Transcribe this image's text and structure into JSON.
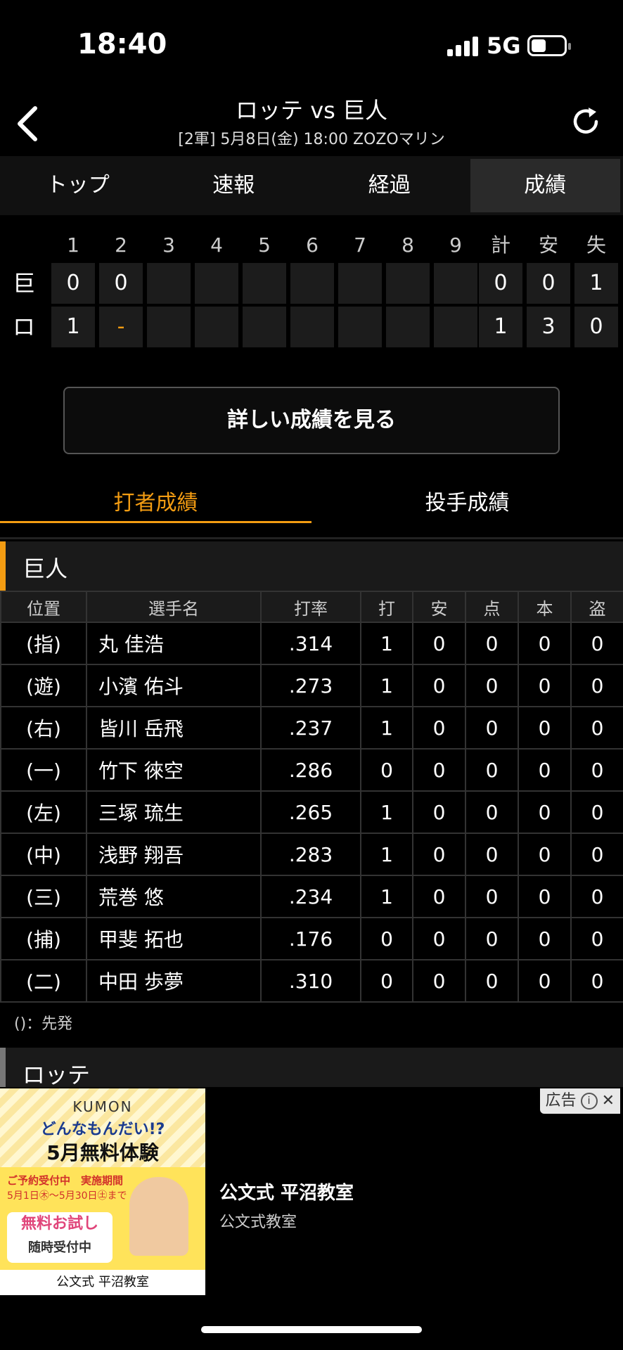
{
  "status": {
    "time": "18:40",
    "network": "5G"
  },
  "header": {
    "title": "ロッテ vs 巨人",
    "subtitle": "[2軍] 5月8日(金) 18:00 ZOZOマリン"
  },
  "tabs": [
    {
      "label": "トップ",
      "active": false
    },
    {
      "label": "速報",
      "active": false
    },
    {
      "label": "経過",
      "active": false
    },
    {
      "label": "成績",
      "active": true
    }
  ],
  "scoreboard": {
    "headers": [
      "1",
      "2",
      "3",
      "4",
      "5",
      "6",
      "7",
      "8",
      "9",
      "計",
      "安",
      "失"
    ],
    "teams": [
      {
        "name": "巨",
        "innings": [
          "0",
          "0",
          "",
          "",
          "",
          "",
          "",
          "",
          ""
        ],
        "totals": [
          "0",
          "0",
          "1"
        ]
      },
      {
        "name": "ロ",
        "innings": [
          "1",
          "-",
          "",
          "",
          "",
          "",
          "",
          "",
          ""
        ],
        "totals": [
          "1",
          "3",
          "0"
        ]
      }
    ]
  },
  "details_button": "詳しい成績を見る",
  "subtabs": {
    "batting": "打者成績",
    "pitching": "投手成績"
  },
  "section": {
    "team": "巨人",
    "accent": "#f39c12",
    "columns": [
      "位置",
      "選手名",
      "打率",
      "打",
      "安",
      "点",
      "本",
      "盗"
    ],
    "rows": [
      [
        "(指)",
        "丸 佳浩",
        ".314",
        "1",
        "0",
        "0",
        "0",
        "0"
      ],
      [
        "(遊)",
        "小濱 佑斗",
        ".273",
        "1",
        "0",
        "0",
        "0",
        "0"
      ],
      [
        "(右)",
        "皆川 岳飛",
        ".237",
        "1",
        "0",
        "0",
        "0",
        "0"
      ],
      [
        "(一)",
        "竹下 徠空",
        ".286",
        "0",
        "0",
        "0",
        "0",
        "0"
      ],
      [
        "(左)",
        "三塚 琉生",
        ".265",
        "1",
        "0",
        "0",
        "0",
        "0"
      ],
      [
        "(中)",
        "浅野 翔吾",
        ".283",
        "1",
        "0",
        "0",
        "0",
        "0"
      ],
      [
        "(三)",
        "荒巻 悠",
        ".234",
        "1",
        "0",
        "0",
        "0",
        "0"
      ],
      [
        "(捕)",
        "甲斐 拓也",
        ".176",
        "0",
        "0",
        "0",
        "0",
        "0"
      ],
      [
        "(二)",
        "中田 歩夢",
        ".310",
        "0",
        "0",
        "0",
        "0",
        "0"
      ]
    ],
    "note": "()：先発"
  },
  "next_team": "ロッテ",
  "ad": {
    "badge": "広告",
    "brand": "KUMON",
    "catch": "どんなもんだい!?",
    "headline": "5月無料体験",
    "reservation": "ご予約受付中　実施期間",
    "period": "5月1日㊍～5月30日㊏まで",
    "free_trial": "無料お試し",
    "free_trial_sub": "随時受付中",
    "footer": "公文式 平沼教室",
    "title": "公文式 平沼教室",
    "subtitle": "公文式教室"
  }
}
